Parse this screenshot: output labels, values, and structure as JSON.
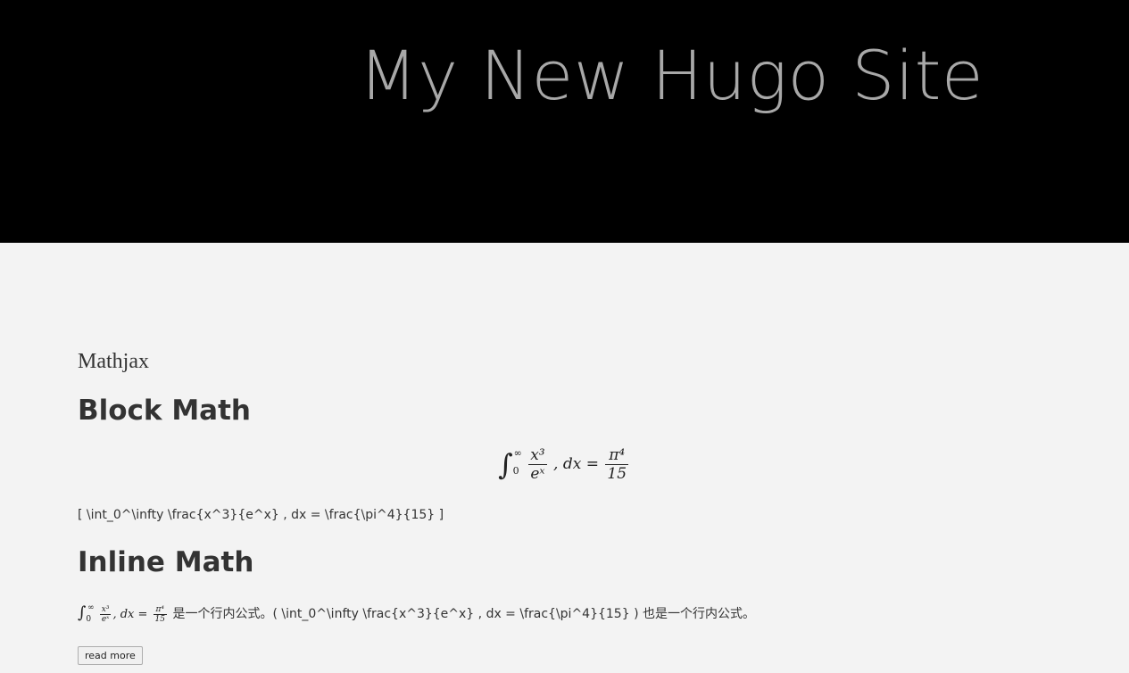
{
  "header": {
    "site_title": "My New Hugo Site"
  },
  "post": {
    "title": "Mathjax",
    "block_heading": "Block Math",
    "block_formula": {
      "integral": "∫",
      "lower": "0",
      "upper": "∞",
      "num": "x³",
      "den": "eˣ",
      "middle": ", dx =",
      "rhs_num": "π⁴",
      "rhs_den": "15"
    },
    "block_raw": "[ \\int_0^\\infty \\frac{x^3}{e^x} , dx = \\frac{\\pi^4}{15} ]",
    "inline_heading": "Inline Math",
    "inline_formula": {
      "integral": "∫",
      "lower": "0",
      "upper": "∞",
      "num": "x³",
      "den": "eˣ",
      "middle": ", dx =",
      "rhs_num": "π⁴",
      "rhs_den": "15"
    },
    "inline_text": " 是一个行内公式。( \\int_0^\\infty \\frac{x^3}{e^x} , dx = \\frac{\\pi^4}{15} ) 也是一个行内公式。",
    "read_more_label": "read more"
  }
}
